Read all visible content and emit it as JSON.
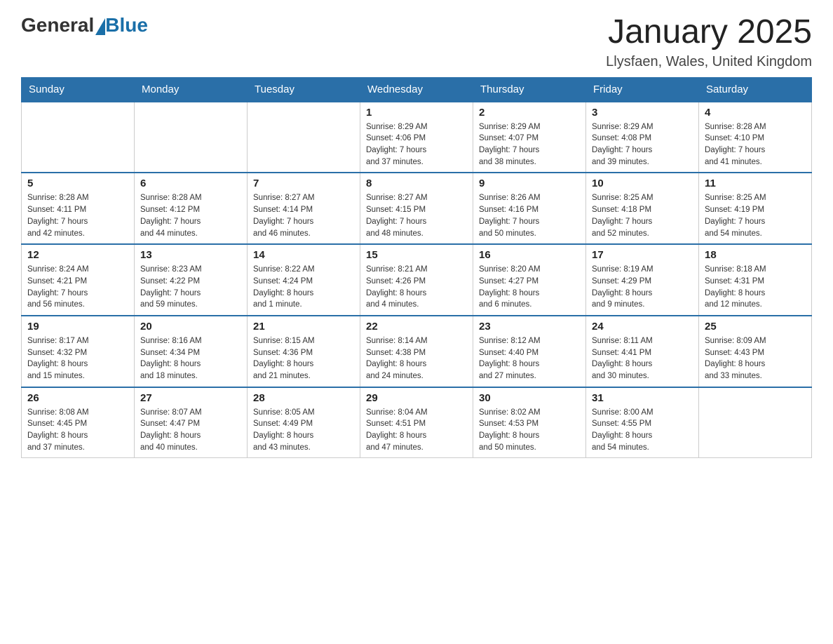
{
  "header": {
    "logo_general": "General",
    "logo_blue": "Blue",
    "title": "January 2025",
    "subtitle": "Llysfaen, Wales, United Kingdom"
  },
  "days_of_week": [
    "Sunday",
    "Monday",
    "Tuesday",
    "Wednesday",
    "Thursday",
    "Friday",
    "Saturday"
  ],
  "weeks": [
    [
      {
        "day": "",
        "info": ""
      },
      {
        "day": "",
        "info": ""
      },
      {
        "day": "",
        "info": ""
      },
      {
        "day": "1",
        "info": "Sunrise: 8:29 AM\nSunset: 4:06 PM\nDaylight: 7 hours\nand 37 minutes."
      },
      {
        "day": "2",
        "info": "Sunrise: 8:29 AM\nSunset: 4:07 PM\nDaylight: 7 hours\nand 38 minutes."
      },
      {
        "day": "3",
        "info": "Sunrise: 8:29 AM\nSunset: 4:08 PM\nDaylight: 7 hours\nand 39 minutes."
      },
      {
        "day": "4",
        "info": "Sunrise: 8:28 AM\nSunset: 4:10 PM\nDaylight: 7 hours\nand 41 minutes."
      }
    ],
    [
      {
        "day": "5",
        "info": "Sunrise: 8:28 AM\nSunset: 4:11 PM\nDaylight: 7 hours\nand 42 minutes."
      },
      {
        "day": "6",
        "info": "Sunrise: 8:28 AM\nSunset: 4:12 PM\nDaylight: 7 hours\nand 44 minutes."
      },
      {
        "day": "7",
        "info": "Sunrise: 8:27 AM\nSunset: 4:14 PM\nDaylight: 7 hours\nand 46 minutes."
      },
      {
        "day": "8",
        "info": "Sunrise: 8:27 AM\nSunset: 4:15 PM\nDaylight: 7 hours\nand 48 minutes."
      },
      {
        "day": "9",
        "info": "Sunrise: 8:26 AM\nSunset: 4:16 PM\nDaylight: 7 hours\nand 50 minutes."
      },
      {
        "day": "10",
        "info": "Sunrise: 8:25 AM\nSunset: 4:18 PM\nDaylight: 7 hours\nand 52 minutes."
      },
      {
        "day": "11",
        "info": "Sunrise: 8:25 AM\nSunset: 4:19 PM\nDaylight: 7 hours\nand 54 minutes."
      }
    ],
    [
      {
        "day": "12",
        "info": "Sunrise: 8:24 AM\nSunset: 4:21 PM\nDaylight: 7 hours\nand 56 minutes."
      },
      {
        "day": "13",
        "info": "Sunrise: 8:23 AM\nSunset: 4:22 PM\nDaylight: 7 hours\nand 59 minutes."
      },
      {
        "day": "14",
        "info": "Sunrise: 8:22 AM\nSunset: 4:24 PM\nDaylight: 8 hours\nand 1 minute."
      },
      {
        "day": "15",
        "info": "Sunrise: 8:21 AM\nSunset: 4:26 PM\nDaylight: 8 hours\nand 4 minutes."
      },
      {
        "day": "16",
        "info": "Sunrise: 8:20 AM\nSunset: 4:27 PM\nDaylight: 8 hours\nand 6 minutes."
      },
      {
        "day": "17",
        "info": "Sunrise: 8:19 AM\nSunset: 4:29 PM\nDaylight: 8 hours\nand 9 minutes."
      },
      {
        "day": "18",
        "info": "Sunrise: 8:18 AM\nSunset: 4:31 PM\nDaylight: 8 hours\nand 12 minutes."
      }
    ],
    [
      {
        "day": "19",
        "info": "Sunrise: 8:17 AM\nSunset: 4:32 PM\nDaylight: 8 hours\nand 15 minutes."
      },
      {
        "day": "20",
        "info": "Sunrise: 8:16 AM\nSunset: 4:34 PM\nDaylight: 8 hours\nand 18 minutes."
      },
      {
        "day": "21",
        "info": "Sunrise: 8:15 AM\nSunset: 4:36 PM\nDaylight: 8 hours\nand 21 minutes."
      },
      {
        "day": "22",
        "info": "Sunrise: 8:14 AM\nSunset: 4:38 PM\nDaylight: 8 hours\nand 24 minutes."
      },
      {
        "day": "23",
        "info": "Sunrise: 8:12 AM\nSunset: 4:40 PM\nDaylight: 8 hours\nand 27 minutes."
      },
      {
        "day": "24",
        "info": "Sunrise: 8:11 AM\nSunset: 4:41 PM\nDaylight: 8 hours\nand 30 minutes."
      },
      {
        "day": "25",
        "info": "Sunrise: 8:09 AM\nSunset: 4:43 PM\nDaylight: 8 hours\nand 33 minutes."
      }
    ],
    [
      {
        "day": "26",
        "info": "Sunrise: 8:08 AM\nSunset: 4:45 PM\nDaylight: 8 hours\nand 37 minutes."
      },
      {
        "day": "27",
        "info": "Sunrise: 8:07 AM\nSunset: 4:47 PM\nDaylight: 8 hours\nand 40 minutes."
      },
      {
        "day": "28",
        "info": "Sunrise: 8:05 AM\nSunset: 4:49 PM\nDaylight: 8 hours\nand 43 minutes."
      },
      {
        "day": "29",
        "info": "Sunrise: 8:04 AM\nSunset: 4:51 PM\nDaylight: 8 hours\nand 47 minutes."
      },
      {
        "day": "30",
        "info": "Sunrise: 8:02 AM\nSunset: 4:53 PM\nDaylight: 8 hours\nand 50 minutes."
      },
      {
        "day": "31",
        "info": "Sunrise: 8:00 AM\nSunset: 4:55 PM\nDaylight: 8 hours\nand 54 minutes."
      },
      {
        "day": "",
        "info": ""
      }
    ]
  ]
}
